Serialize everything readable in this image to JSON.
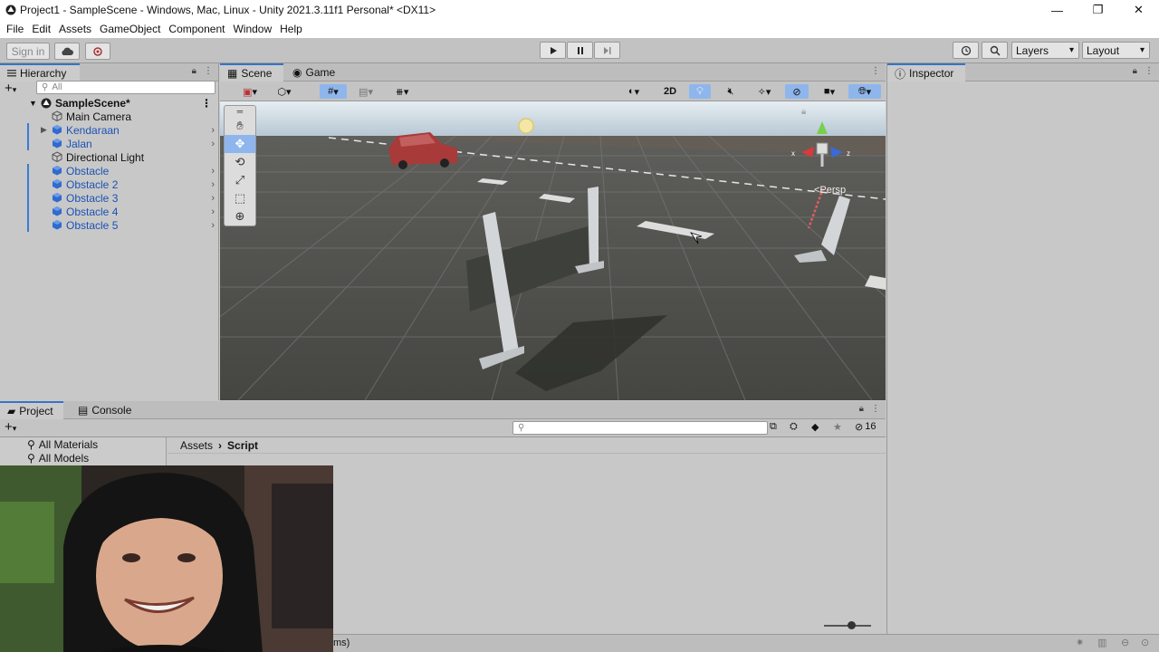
{
  "window": {
    "title": "Project1 - SampleScene - Windows, Mac, Linux - Unity 2021.3.11f1 Personal* <DX11>",
    "controls": [
      "—",
      "❐",
      "✕"
    ]
  },
  "menu": [
    "File",
    "Edit",
    "Assets",
    "GameObject",
    "Component",
    "Window",
    "Help"
  ],
  "toolbar": {
    "sign_in": "Sign in",
    "layers": "Layers",
    "layout": "Layout"
  },
  "hierarchy": {
    "tab": "Hierarchy",
    "search_placeholder": "All",
    "scene": "SampleScene*",
    "items": [
      {
        "label": "Main Camera",
        "prefab": false,
        "arrow": false,
        "expand": false
      },
      {
        "label": "Kendaraan",
        "prefab": true,
        "arrow": true,
        "expand": true
      },
      {
        "label": "Jalan",
        "prefab": true,
        "arrow": true,
        "expand": false
      },
      {
        "label": "Directional Light",
        "prefab": false,
        "arrow": false,
        "expand": false
      },
      {
        "label": "Obstacle",
        "prefab": true,
        "arrow": true,
        "expand": false
      },
      {
        "label": "Obstacle 2",
        "prefab": true,
        "arrow": true,
        "expand": false
      },
      {
        "label": "Obstacle 3",
        "prefab": true,
        "arrow": true,
        "expand": false
      },
      {
        "label": "Obstacle 4",
        "prefab": true,
        "arrow": true,
        "expand": false
      },
      {
        "label": "Obstacle 5",
        "prefab": true,
        "arrow": true,
        "expand": false
      }
    ]
  },
  "scene_view": {
    "tabs": [
      "Scene",
      "Game"
    ],
    "mode_2d": "2D",
    "persp_label": "<Persp"
  },
  "inspector": {
    "tab": "Inspector"
  },
  "project": {
    "tabs": [
      "Project",
      "Console"
    ],
    "hidden_count": "16",
    "tree": [
      "All Materials",
      "All Models"
    ],
    "breadcrumb": [
      "Assets",
      "Script"
    ]
  },
  "status": {
    "text": "ms)"
  },
  "colors": {
    "accent": "#3a72c8",
    "prefab_blue": "#1c52b5",
    "selection": "#8fb6ec",
    "sky": "#c9dbe8",
    "ground": "#4a4b48"
  }
}
